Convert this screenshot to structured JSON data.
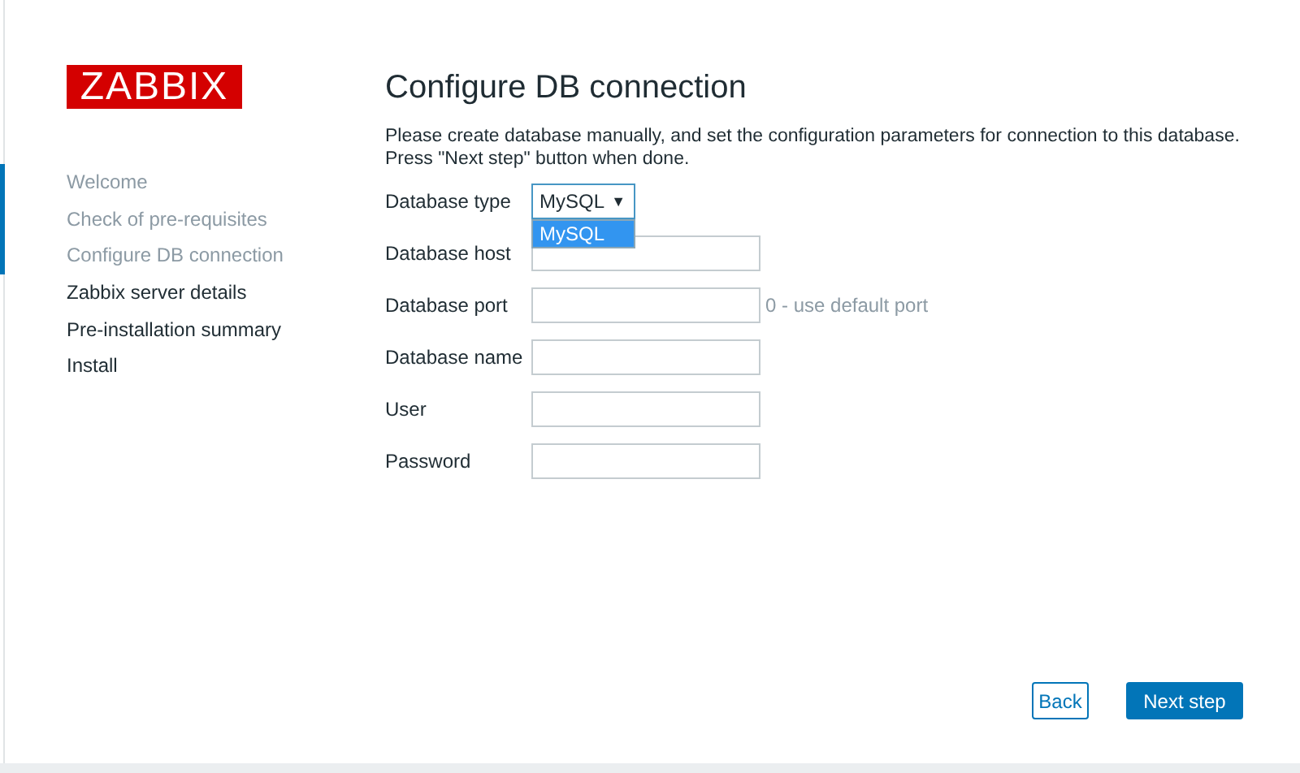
{
  "logo": {
    "text": "ZABBIX"
  },
  "steps": [
    {
      "label": "Welcome",
      "done": true
    },
    {
      "label": "Check of pre-requisites",
      "done": true
    },
    {
      "label": "Configure DB connection",
      "done": true
    },
    {
      "label": "Zabbix server details",
      "done": false
    },
    {
      "label": "Pre-installation summary",
      "done": false
    },
    {
      "label": "Install",
      "done": false
    }
  ],
  "title": "Configure DB connection",
  "description": [
    "Please create database manually, and set the configuration parameters for connection to this database.",
    "Press \"Next step\" button when done."
  ],
  "fields": [
    {
      "kind": "select",
      "label": "Database type",
      "value": "MySQL",
      "caret": "▼",
      "expanded": true,
      "options": [
        {
          "label": "MySQL",
          "selected": true
        }
      ]
    },
    {
      "kind": "text",
      "label": "Database host"
    },
    {
      "kind": "text",
      "label": "Database port",
      "hint": "0 - use default port"
    },
    {
      "kind": "text",
      "label": "Database name"
    },
    {
      "kind": "text",
      "label": "User"
    },
    {
      "kind": "password",
      "label": "Password"
    }
  ],
  "buttons": [
    {
      "label": "Back",
      "kind": "secondary"
    },
    {
      "label": "Next step",
      "kind": "primary"
    }
  ]
}
